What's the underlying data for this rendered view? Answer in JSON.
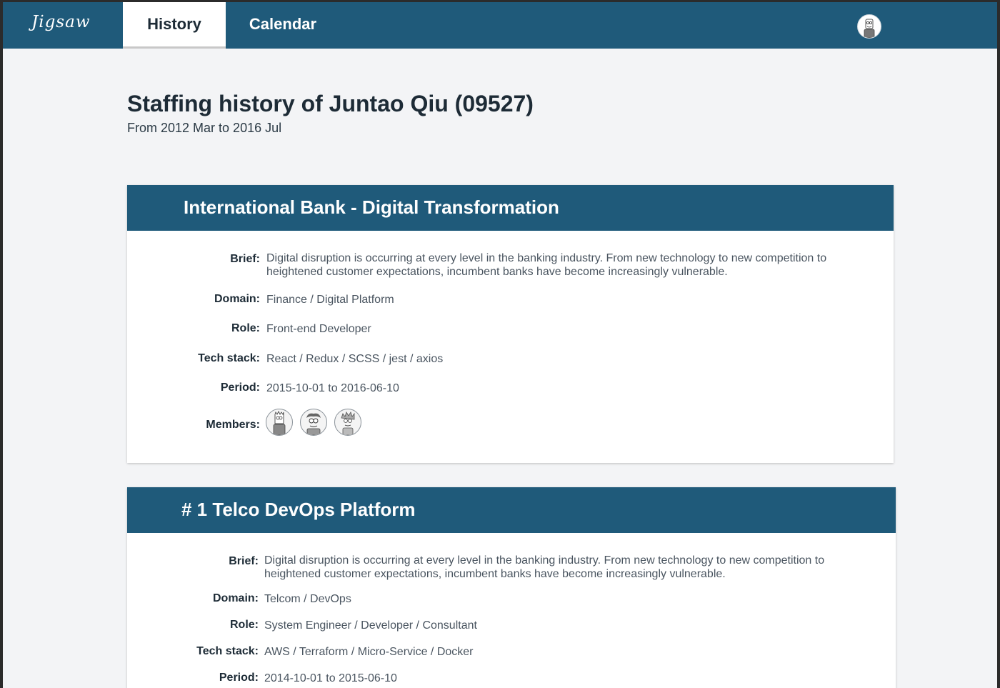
{
  "nav": {
    "logo": "Jigsaw",
    "tabs": [
      {
        "label": "History",
        "active": true
      },
      {
        "label": "Calendar",
        "active": false
      }
    ],
    "user_avatar_icon": "user-avatar-icon",
    "color": "#1f5a7a"
  },
  "page": {
    "title": "Staffing history of Juntao Qiu (09527)",
    "subtitle": "From 2012 Mar to 2016 Jul"
  },
  "labels": {
    "brief": "Brief:",
    "domain": "Domain:",
    "role": "Role:",
    "tech_stack": "Tech stack:",
    "period": "Period:",
    "members": "Members:"
  },
  "projects": [
    {
      "title": "International Bank - Digital Transformation",
      "brief": "Digital disruption is occurring at every level in the banking industry. From new technology to new competition to heightened customer expectations, incumbent banks have become increasingly vulnerable.",
      "domain": "Finance / Digital Platform",
      "role": "Front-end Developer",
      "tech_stack": "React / Redux / SCSS / jest / axios",
      "period": "2015-10-01 to 2016-06-10",
      "members": [
        "member-avatar-icon",
        "member-avatar-icon",
        "member-avatar-icon"
      ]
    },
    {
      "title": "# 1 Telco DevOps Platform",
      "brief": "Digital disruption is occurring at every level in the banking industry. From new technology to new competition to heightened customer expectations, incumbent banks have become increasingly vulnerable.",
      "domain": "Telcom / DevOps",
      "role": "System Engineer / Developer / Consultant",
      "tech_stack": "AWS / Terraform / Micro-Service / Docker",
      "period": "2014-10-01 to 2015-06-10"
    }
  ]
}
